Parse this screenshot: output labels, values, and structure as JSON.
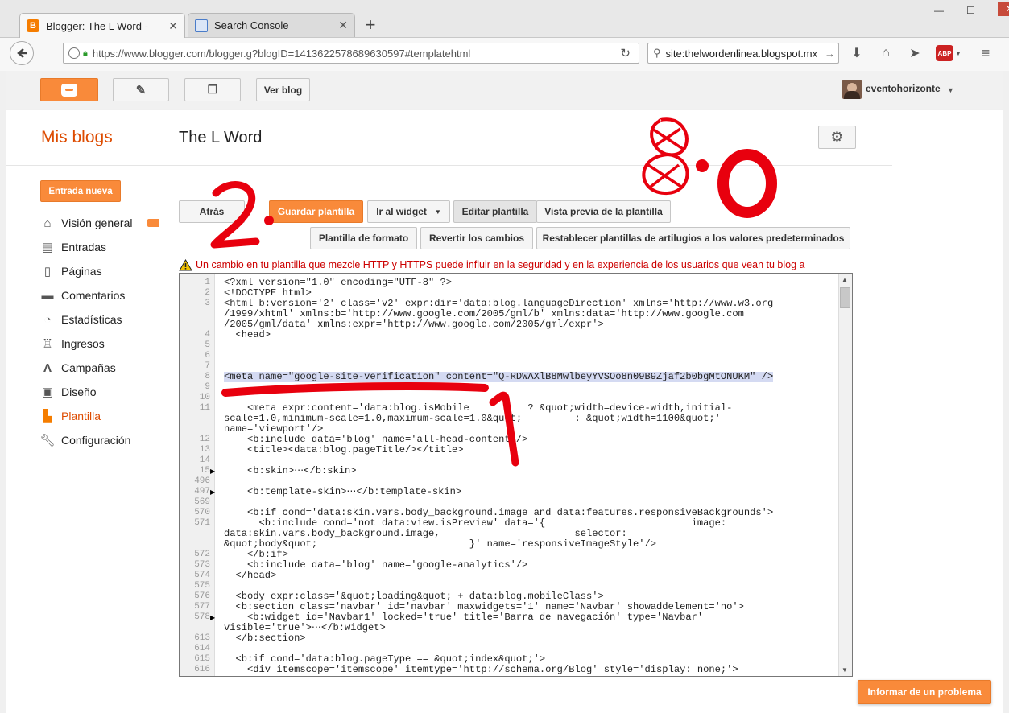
{
  "browser": {
    "tabs": [
      {
        "title": "Blogger: The L Word -",
        "icon": "blogger-icon"
      },
      {
        "title": "Search Console",
        "icon": "search-console-icon"
      }
    ],
    "new_tab_label": "+",
    "url": "https://www.blogger.com/blogger.g?blogID=1413622578689630597#templatehtml",
    "search_text": "site:thelwordenlinea.blogspot.mx",
    "window_controls": [
      "—",
      "☐",
      "✕"
    ]
  },
  "blogger_header": {
    "view_blog_label": "Ver blog",
    "username": "eventohorizonte"
  },
  "sidebar": {
    "my_blogs_label": "Mis blogs",
    "new_post_label": "Entrada nueva",
    "items": [
      {
        "label": "Visión general",
        "icon": "home-icon"
      },
      {
        "label": "Entradas",
        "icon": "posts-icon"
      },
      {
        "label": "Páginas",
        "icon": "pages-icon"
      },
      {
        "label": "Comentarios",
        "icon": "comments-icon"
      },
      {
        "label": "Estadísticas",
        "icon": "stats-icon"
      },
      {
        "label": "Ingresos",
        "icon": "trophy-icon"
      },
      {
        "label": "Campañas",
        "icon": "campaigns-icon"
      },
      {
        "label": "Diseño",
        "icon": "layout-icon"
      },
      {
        "label": "Plantilla",
        "icon": "template-icon"
      },
      {
        "label": "Configuración",
        "icon": "wrench-icon"
      }
    ],
    "selected": "Plantilla"
  },
  "main": {
    "blog_title": "The L Word",
    "toolbar": {
      "back_label": "Atrás",
      "save_label": "Guardar plantilla",
      "goto_widget_label": "Ir al widget",
      "edit_label": "Editar plantilla",
      "preview_label": "Vista previa de la plantilla",
      "format_label": "Plantilla de formato",
      "revert_label": "Revertir los cambios",
      "reset_label": "Restablecer plantillas de artilugios a los valores predeterminados"
    },
    "warning": "Un cambio en tu plantilla que mezcle HTTP y HTTPS puede influir en la seguridad y en la experiencia de los usuarios que vean tu blog a",
    "report_label": "Informar de un problema"
  },
  "annotations": {
    "number_2": "2.",
    "number_1": "1",
    "number_8": "8",
    "number_0": "0"
  },
  "editor": {
    "lines": [
      {
        "n": "1",
        "text": "<?xml version=\"1.0\" encoding=\"UTF-8\" ?>"
      },
      {
        "n": "2",
        "text": "<!DOCTYPE html>"
      },
      {
        "n": "3",
        "text": "<html b:version='2' class='v2' expr:dir='data:blog.languageDirection' xmlns='http://www.w3.org"
      },
      {
        "n": "",
        "text": "/1999/xhtml' xmlns:b='http://www.google.com/2005/gml/b' xmlns:data='http://www.google.com"
      },
      {
        "n": "",
        "text": "/2005/gml/data' xmlns:expr='http://www.google.com/2005/gml/expr'>"
      },
      {
        "n": "4",
        "text": "  <head>"
      },
      {
        "n": "5",
        "text": ""
      },
      {
        "n": "6",
        "text": ""
      },
      {
        "n": "7",
        "text": ""
      },
      {
        "n": "8",
        "text": "<meta name=\"google-site-verification\" content=\"Q-RDWAXlB8MwlbeyYVSOo8n09B9Zjaf2b0bgMtONUKM\" />",
        "highlight": true
      },
      {
        "n": "9",
        "text": ""
      },
      {
        "n": "10",
        "text": ""
      },
      {
        "n": "11",
        "text": "    <meta expr:content='data:blog.isMobile          ? &quot;width=device-width,initial-"
      },
      {
        "n": "",
        "text": "scale=1.0,minimum-scale=1.0,maximum-scale=1.0&quot;         : &quot;width=1100&quot;'"
      },
      {
        "n": "",
        "text": "name='viewport'/>"
      },
      {
        "n": "12",
        "text": "    <b:include data='blog' name='all-head-content'/>"
      },
      {
        "n": "13",
        "text": "    <title><data:blog.pageTitle/></title>"
      },
      {
        "n": "14",
        "text": ""
      },
      {
        "n": "15",
        "text": "    <b:skin>⋯</b:skin>",
        "fold": true
      },
      {
        "n": "496",
        "text": ""
      },
      {
        "n": "497",
        "text": "    <b:template-skin>⋯</b:template-skin>",
        "fold": true
      },
      {
        "n": "569",
        "text": ""
      },
      {
        "n": "570",
        "text": "    <b:if cond='data:skin.vars.body_background.image and data:features.responsiveBackgrounds'>"
      },
      {
        "n": "571",
        "text": "      <b:include cond='not data:view.isPreview' data='{                         image:"
      },
      {
        "n": "",
        "text": "data:skin.vars.body_background.image,                       selector:"
      },
      {
        "n": "",
        "text": "&quot;body&quot;                          }' name='responsiveImageStyle'/>"
      },
      {
        "n": "572",
        "text": "    </b:if>"
      },
      {
        "n": "573",
        "text": "    <b:include data='blog' name='google-analytics'/>"
      },
      {
        "n": "574",
        "text": "  </head>"
      },
      {
        "n": "575",
        "text": ""
      },
      {
        "n": "576",
        "text": "  <body expr:class='&quot;loading&quot; + data:blog.mobileClass'>"
      },
      {
        "n": "577",
        "text": "  <b:section class='navbar' id='navbar' maxwidgets='1' name='Navbar' showaddelement='no'>"
      },
      {
        "n": "578",
        "text": "    <b:widget id='Navbar1' locked='true' title='Barra de navegación' type='Navbar'",
        "fold": true
      },
      {
        "n": "",
        "text": "visible='true'>⋯</b:widget>"
      },
      {
        "n": "613",
        "text": "  </b:section>"
      },
      {
        "n": "614",
        "text": ""
      },
      {
        "n": "615",
        "text": "  <b:if cond='data:blog.pageType == &quot;index&quot;'>"
      },
      {
        "n": "616",
        "text": "    <div itemscope='itemscope' itemtype='http://schema.org/Blog' style='display: none;'>"
      }
    ]
  }
}
